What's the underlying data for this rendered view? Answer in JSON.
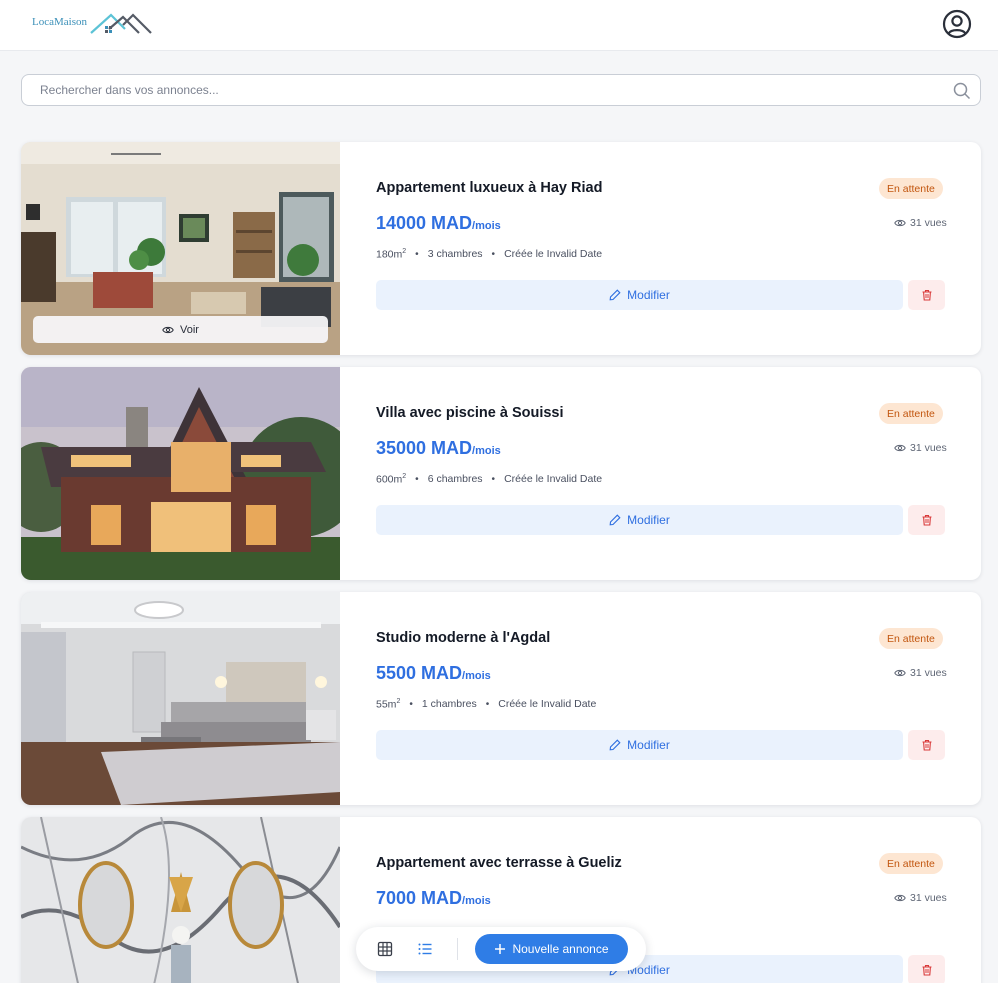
{
  "app": {
    "logo_text": "LocaMaison"
  },
  "search": {
    "placeholder": "Rechercher dans vos annonces..."
  },
  "voir_label": "Voir",
  "listings": [
    {
      "title": "Appartement luxueux à Hay Riad",
      "status": "En attente",
      "price": "14000 MAD",
      "price_unit": "/mois",
      "views": "31 vues",
      "area": "180m",
      "area_sup": "2",
      "rooms": "3 chambres",
      "created": "Créée le Invalid Date",
      "modify_label": "Modifier"
    },
    {
      "title": "Villa avec piscine à Souissi",
      "status": "En attente",
      "price": "35000 MAD",
      "price_unit": "/mois",
      "views": "31 vues",
      "area": "600m",
      "area_sup": "2",
      "rooms": "6 chambres",
      "created": "Créée le Invalid Date",
      "modify_label": "Modifier"
    },
    {
      "title": "Studio moderne à l'Agdal",
      "status": "En attente",
      "price": "5500 MAD",
      "price_unit": "/mois",
      "views": "31 vues",
      "area": "55m",
      "area_sup": "2",
      "rooms": "1 chambres",
      "created": "Créée le Invalid Date",
      "modify_label": "Modifier"
    },
    {
      "title": "Appartement avec terrasse à Gueliz",
      "status": "En attente",
      "price": "7000 MAD",
      "price_unit": "/mois",
      "views": "31 vues",
      "modify_label": "Modifier"
    }
  ],
  "dock": {
    "new_label": "Nouvelle annonce"
  },
  "colors": {
    "accent": "#2f7de6",
    "price": "#2f6fe0",
    "badge_bg": "#fde6d2",
    "badge_text": "#c2560f",
    "delete": "#d93a3a"
  },
  "icons": {
    "account": "user-circle-icon",
    "search": "search-icon",
    "eye": "eye-icon",
    "pencil": "pencil-icon",
    "trash": "trash-icon",
    "grid": "grid-icon",
    "list": "list-icon",
    "plus": "plus-icon"
  }
}
